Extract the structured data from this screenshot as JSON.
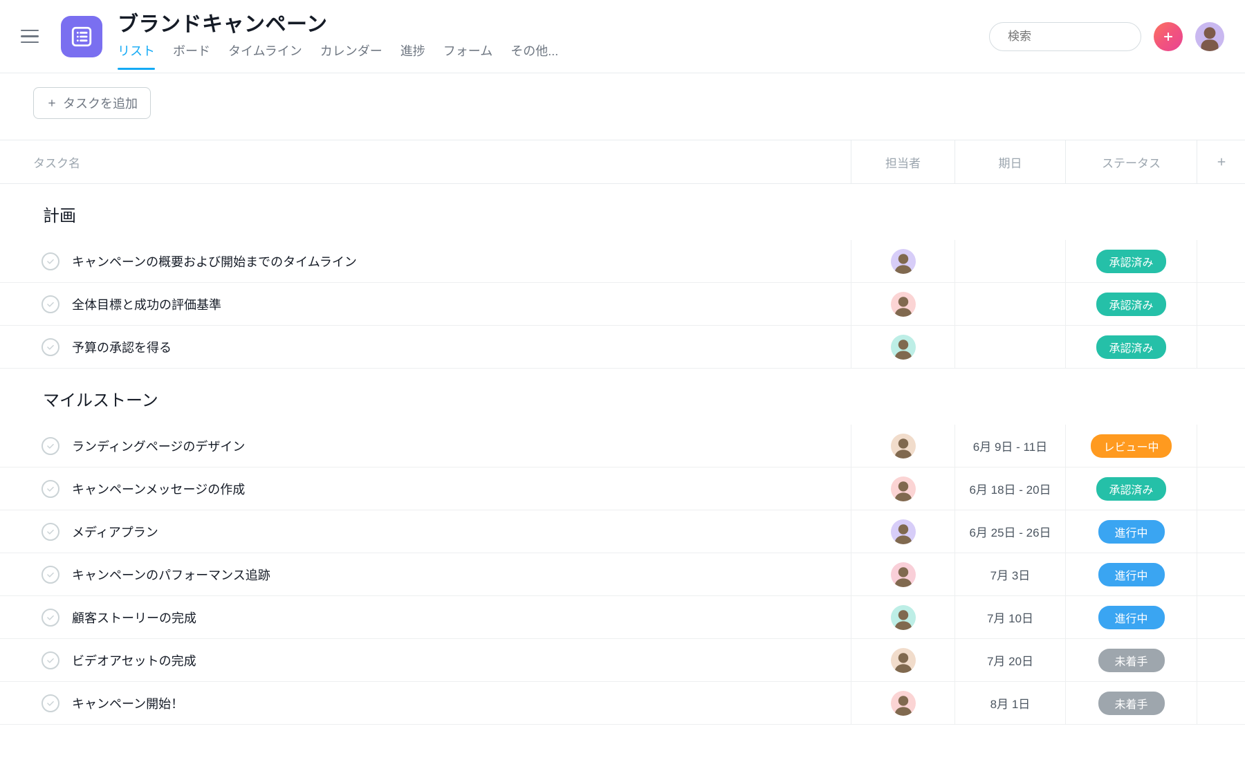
{
  "header": {
    "title": "ブランドキャンペーン",
    "tabs": [
      "リスト",
      "ボード",
      "タイムライン",
      "カレンダー",
      "進捗",
      "フォーム",
      "その他..."
    ],
    "active_tab": 0,
    "search_placeholder": "検索"
  },
  "toolbar": {
    "add_task_label": "タスクを追加"
  },
  "columns": {
    "task": "タスク名",
    "assignee": "担当者",
    "due": "期日",
    "status": "ステータス"
  },
  "status_palette": {
    "approved": "承認済み",
    "review": "レビュー中",
    "progress": "進行中",
    "notstart": "未着手"
  },
  "sections": [
    {
      "title": "計画",
      "tasks": [
        {
          "name": "キャンペーンの概要および開始までのタイムライン",
          "assignee_color": "bg-purple",
          "due": "",
          "status": "approved"
        },
        {
          "name": "全体目標と成功の評価基準",
          "assignee_color": "bg-pink",
          "due": "",
          "status": "approved"
        },
        {
          "name": "予算の承認を得る",
          "assignee_color": "bg-teal",
          "due": "",
          "status": "approved"
        }
      ]
    },
    {
      "title": "マイルストーン",
      "tasks": [
        {
          "name": "ランディングページのデザイン",
          "assignee_color": "bg-tan",
          "due": "6月 9日 - 11日",
          "status": "review"
        },
        {
          "name": "キャンペーンメッセージの作成",
          "assignee_color": "bg-pink",
          "due": "6月 18日 - 20日",
          "status": "approved"
        },
        {
          "name": "メディアプラン",
          "assignee_color": "bg-purple",
          "due": "6月 25日 - 26日",
          "status": "progress"
        },
        {
          "name": "キャンペーンのパフォーマンス追跡",
          "assignee_color": "bg-pink2",
          "due": "7月 3日",
          "status": "progress"
        },
        {
          "name": "顧客ストーリーの完成",
          "assignee_color": "bg-teal",
          "due": "7月 10日",
          "status": "progress"
        },
        {
          "name": "ビデオアセットの完成",
          "assignee_color": "bg-tan",
          "due": "7月 20日",
          "status": "notstart"
        },
        {
          "name": "キャンペーン開始！",
          "assignee_color": "bg-pink",
          "due": "8月 1日",
          "status": "notstart"
        }
      ]
    }
  ]
}
